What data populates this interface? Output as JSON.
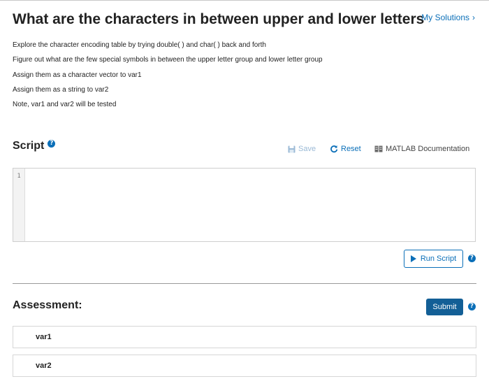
{
  "problem": {
    "title": "What are the characters in between upper and lower letters",
    "my_solutions_label": "My Solutions",
    "description": [
      "Explore the character encoding table by trying double( ) and char( ) back and forth",
      "Figure out what are the few special symbols in between the upper letter group and lower letter group",
      "Assign them as a character vector to var1",
      "Assign them as a string to var2",
      "Note, var1 and var2 will be tested"
    ]
  },
  "script": {
    "heading": "Script",
    "toolbar": {
      "save_label": "Save",
      "reset_label": "Reset",
      "documentation_label": "MATLAB Documentation"
    },
    "editor": {
      "line_numbers": [
        "1"
      ],
      "content": ""
    },
    "run_label": "Run Script"
  },
  "assessment": {
    "heading": "Assessment:",
    "submit_label": "Submit",
    "items": [
      {
        "label": "var1"
      },
      {
        "label": "var2"
      }
    ]
  },
  "icons": {
    "help": "help-icon",
    "save": "floppy-disk-icon",
    "reset": "refresh-icon",
    "documentation": "book-icon",
    "run": "play-icon",
    "chevron": "chevron-right-icon"
  },
  "colors": {
    "accent": "#0b6fb8",
    "submit_bg": "#135f96",
    "disabled": "#9bbad6",
    "text": "#222222"
  }
}
